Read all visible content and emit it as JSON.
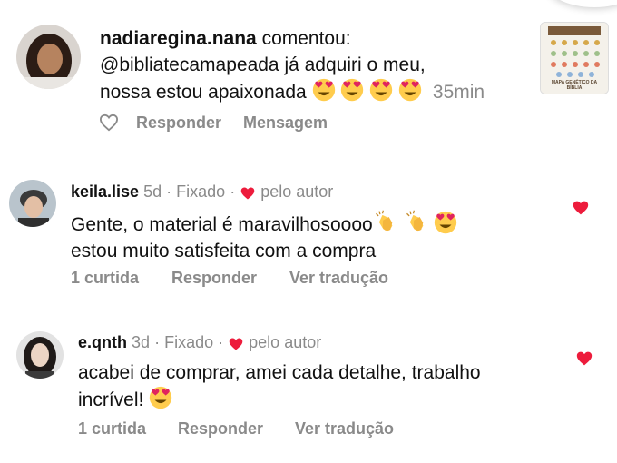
{
  "comment_main": {
    "username": "nadiaregina.nana",
    "verb": "comentou:",
    "line1": "@bibliatecamapeada já adquiri o meu,",
    "line2": "nossa estou apaixonada",
    "emoji_count": 4,
    "time": "35min",
    "actions": {
      "reply": "Responder",
      "message": "Mensagem"
    },
    "post_thumbnail_caption": "MAPA GENÉTICO DA BÍBLIA"
  },
  "replies": [
    {
      "username": "keila.lise",
      "time": "5d",
      "sep1": "·",
      "pinned": "Fixado",
      "sep2": "·",
      "by_author": "pelo autor",
      "line1": "Gente, o material é maravilhosoooo",
      "line2": "estou muito satisfeita com a compra",
      "likes": "1 curtida",
      "reply": "Responder",
      "translate": "Ver tradução",
      "liked": true
    },
    {
      "username": "e.qnth",
      "time": "3d",
      "sep1": "·",
      "pinned": "Fixado",
      "sep2": "·",
      "by_author": "pelo autor",
      "line1": "acabei de comprar, amei cada detalhe, trabalho",
      "line2": "incrível!",
      "likes": "1 curtida",
      "reply": "Responder",
      "translate": "Ver tradução",
      "liked": true
    }
  ],
  "colors": {
    "heart": "#ed1c3c",
    "muted": "#8a8a8a",
    "text": "#111111"
  },
  "icons": [
    "heart-outline-icon",
    "heart-filled-icon",
    "heart-eyes-emoji",
    "clapping-hands-emoji"
  ]
}
